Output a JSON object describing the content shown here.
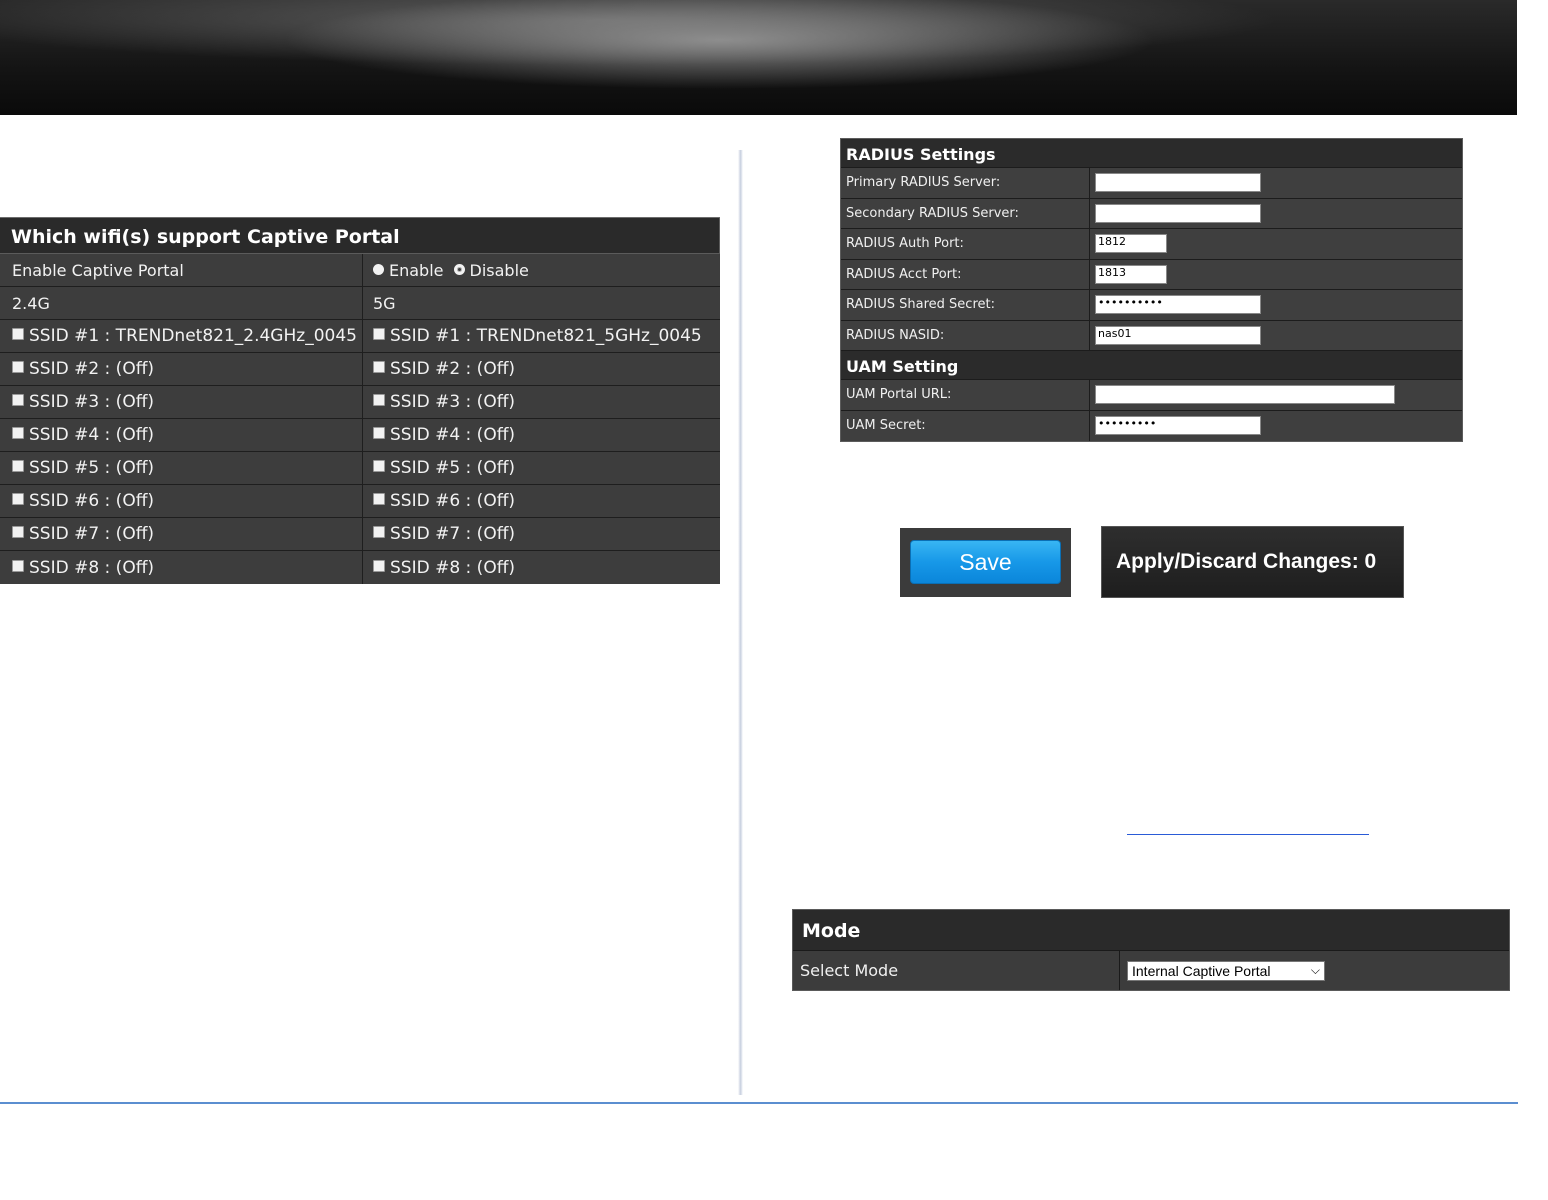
{
  "wifi_table": {
    "title": "Which wifi(s) support Captive Portal",
    "enable_label": "Enable Captive Portal",
    "radio_enable": "Enable",
    "radio_disable": "Disable",
    "col_24": "2.4G",
    "col_5": "5G",
    "ssids_24": [
      "SSID #1 : TRENDnet821_2.4GHz_0045",
      "SSID #2 : (Off)",
      "SSID #3 : (Off)",
      "SSID #4 : (Off)",
      "SSID #5 : (Off)",
      "SSID #6 : (Off)",
      "SSID #7 : (Off)",
      "SSID #8 : (Off)"
    ],
    "ssids_5": [
      "SSID #1 : TRENDnet821_5GHz_0045",
      "SSID #2 : (Off)",
      "SSID #3 : (Off)",
      "SSID #4 : (Off)",
      "SSID #5 : (Off)",
      "SSID #6 : (Off)",
      "SSID #7 : (Off)",
      "SSID #8 : (Off)"
    ]
  },
  "radius": {
    "title": "RADIUS Settings",
    "primary_label": "Primary RADIUS Server:",
    "primary_value": "",
    "secondary_label": "Secondary RADIUS Server:",
    "secondary_value": "",
    "auth_port_label": "RADIUS Auth Port:",
    "auth_port_value": "1812",
    "acct_port_label": "RADIUS Acct Port:",
    "acct_port_value": "1813",
    "secret_label": "RADIUS Shared Secret:",
    "secret_value": "••••••••••",
    "nasid_label": "RADIUS NASID:",
    "nasid_value": "nas01"
  },
  "uam": {
    "title": "UAM Setting",
    "url_label": "UAM Portal URL:",
    "url_value": "",
    "secret_label": "UAM Secret:",
    "secret_value": "•••••••••"
  },
  "buttons": {
    "save": "Save",
    "apply": "Apply/Discard Changes: 0"
  },
  "mode": {
    "title": "Mode",
    "select_label": "Select Mode",
    "selected": "Internal Captive Portal"
  }
}
